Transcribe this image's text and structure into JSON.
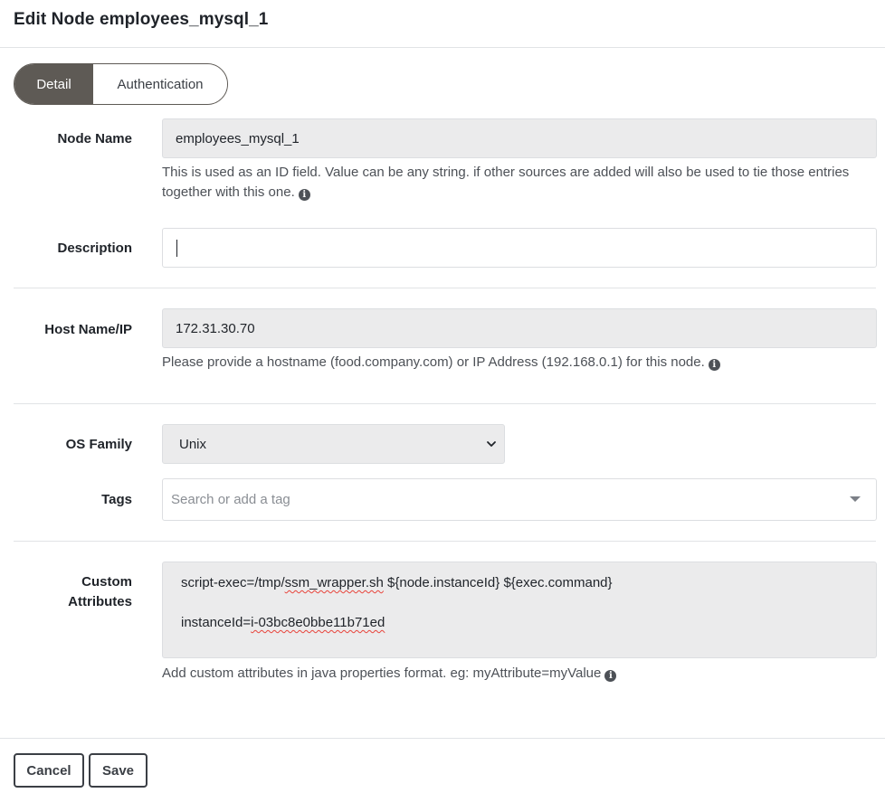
{
  "dialog": {
    "title": "Edit Node employees_mysql_1"
  },
  "tabs": [
    {
      "label": "Detail",
      "active": true
    },
    {
      "label": "Authentication",
      "active": false
    }
  ],
  "fields": {
    "node_name": {
      "label": "Node Name",
      "value": "employees_mysql_1",
      "help": "This is used as an ID field. Value can be any string. if other sources are added will also be used to tie those entries together with this one."
    },
    "description": {
      "label": "Description",
      "value": ""
    },
    "host": {
      "label": "Host Name/IP",
      "value": "172.31.30.70",
      "help": "Please provide a hostname (food.company.com) or IP Address (192.168.0.1) for this node."
    },
    "os_family": {
      "label": "OS Family",
      "selected": "Unix"
    },
    "tags": {
      "label": "Tags",
      "placeholder": "Search or add a tag"
    },
    "custom_attributes": {
      "label_line1": "Custom",
      "label_line2": "Attributes",
      "line1_prefix": "script-exec=/tmp/",
      "line1_misspelled": "ssm_wrapper.sh",
      "line1_suffix": " ${node.instanceId} ${exec.command}",
      "line2_prefix": "instanceId=",
      "line2_misspelled": "i-03bc8e0bbe11b71ed",
      "help": "Add custom attributes in java properties format. eg: myAttribute=myValue"
    }
  },
  "actions": {
    "cancel_label": "Cancel",
    "save_label": "Save"
  },
  "icons": {
    "info": "info-circle-icon",
    "select_chevron": "chevron-down-icon",
    "tags_dropdown": "caret-down-icon"
  },
  "colors": {
    "active_tab": "#5e5a55",
    "readonly_field": "#ebebec",
    "spellcheck_underline": "#e8433a"
  }
}
